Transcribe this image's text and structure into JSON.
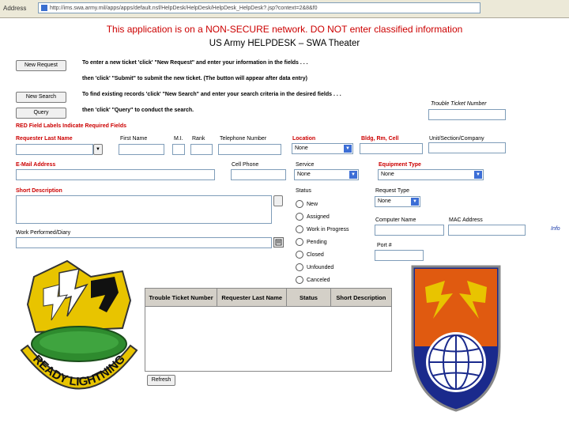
{
  "browser": {
    "address_label": "Address",
    "url": "http://ims.swa.army.mil/apps/apps/default.nsf/HelpDesk/HelpDesk/HelpDesk_HelpDesk?.jsp?context=2&8&f0"
  },
  "header": {
    "warning": "This application is on a NON-SECURE network. DO NOT enter classified information",
    "title": "US Army  HELPDESK – SWA Theater"
  },
  "actions": {
    "new_request_label": "New Request",
    "new_request_text": "To enter a new ticket 'click' \"New Request\" and enter your information in the fields . . .",
    "submit_text": "then 'click' \"Submit\" to submit the new ticket. (The button will appear after data entry)",
    "new_search_label": "New Search",
    "new_search_text": "To find existing records 'click' \"New Search\" and enter your search criteria in the desired fields . . .",
    "query_label": "Query",
    "query_text": "then 'click' \"Query\" to conduct the search."
  },
  "required_note": "RED Field Labels Indicate Required Fields",
  "fields": {
    "trouble_ticket_label": "Trouble Ticket Number",
    "requester_last_name": "Requester Last Name",
    "first_name": "First Name",
    "mi": "M.I.",
    "rank": "Rank",
    "telephone": "Telephone Number",
    "location": "Location",
    "location_value": "None",
    "bldg": "Bldg, Rm, Cell",
    "unit": "Unit/Section/Company",
    "email": "E-Mail Address",
    "cell_phone": "Cell Phone",
    "service": "Service",
    "service_value": "None",
    "equipment_type": "Equipment Type",
    "equipment_value": "None",
    "short_description": "Short Description",
    "status": "Status",
    "request_type": "Request Type",
    "request_type_value": "None",
    "computer_name": "Computer Name",
    "mac_address": "MAC Address",
    "info_link": "Info",
    "port": "Port #",
    "work_performed": "Work Performed/Diary"
  },
  "status_options": [
    "New",
    "Assigned",
    "Work in Progress",
    "Pending",
    "Closed",
    "Unfounded",
    "Canceled"
  ],
  "results": {
    "columns": [
      "Trouble Ticket Number",
      "Requester Last Name",
      "Status",
      "Short Description"
    ],
    "refresh_label": "Refresh"
  },
  "insignia": {
    "left_motto": "READY LIGHTNING"
  },
  "colors": {
    "warning_red": "#cc0000",
    "insignia_gold": "#e8c400",
    "insignia_orange": "#e05a10",
    "insignia_blue": "#1a2a8c",
    "insignia_green": "#2e8b2e"
  }
}
